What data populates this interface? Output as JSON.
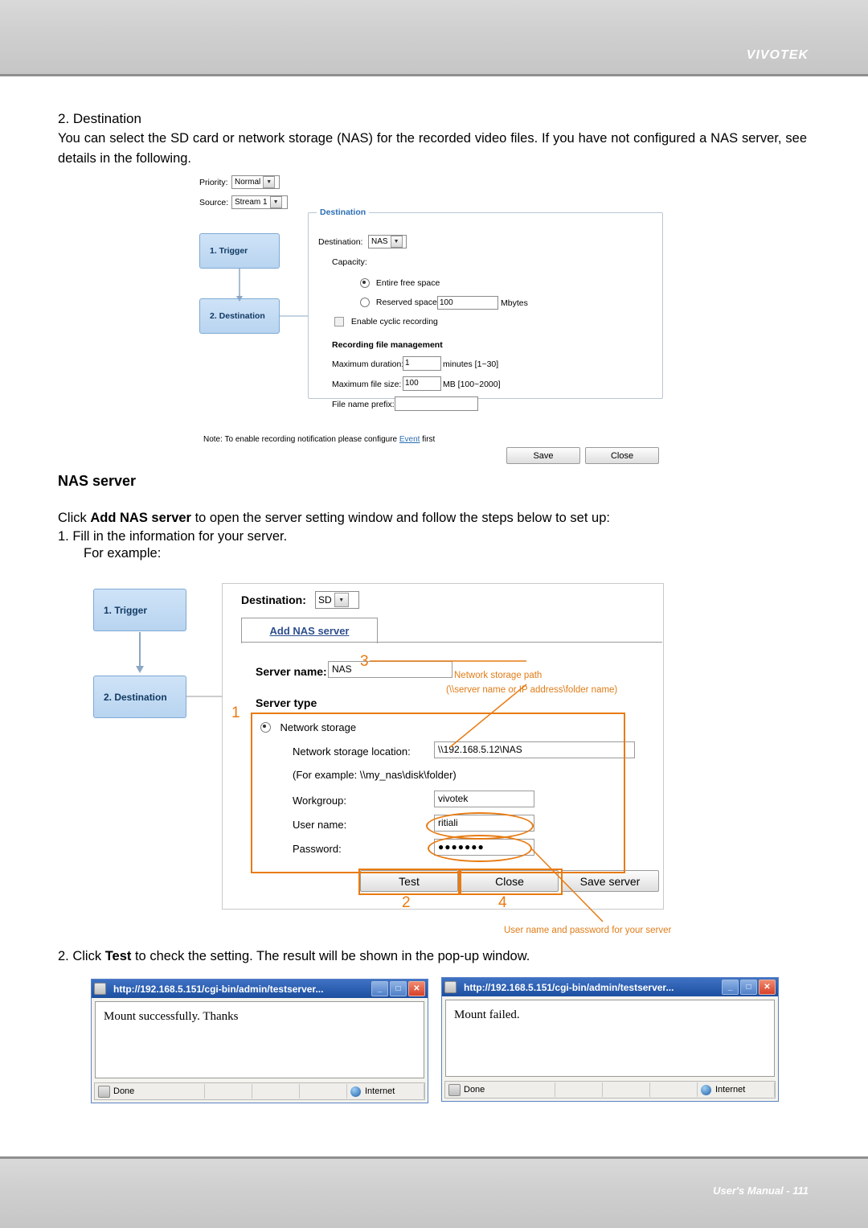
{
  "header": {
    "brand": "VIVOTEK"
  },
  "footer": {
    "text": "User's Manual - 111"
  },
  "content": {
    "section_number": "2. Destination",
    "paragraph1": "You can select the SD card or network storage (NAS) for the recorded video files. If you have not configured a NAS server, see details in the following.",
    "nas_heading": "NAS server",
    "paragraph2_prefix": "Click ",
    "paragraph2_bold": "Add NAS server",
    "paragraph2_suffix": " to open the server setting window and follow the steps below to set up:",
    "step1": "1. Fill in the information for your server.",
    "step1_sub": "For example:",
    "step2_prefix": "2. Click ",
    "step2_bold": "Test",
    "step2_suffix": " to check the setting. The result will be shown in the pop-up window."
  },
  "figure1": {
    "priority_label": "Priority:",
    "priority_value": "Normal",
    "source_label": "Source:",
    "source_value": "Stream 1",
    "node_trigger": "1. Trigger",
    "node_destination": "2. Destination",
    "group_title": "Destination",
    "destination_label": "Destination:",
    "destination_value": "NAS",
    "capacity_label": "Capacity:",
    "entire_free_space": "Entire free space",
    "reserved_space": "Reserved space:",
    "reserved_value": "100",
    "mbytes": "Mbytes",
    "enable_cyclic": "Enable cyclic recording",
    "rec_file_mgmt": "Recording file management",
    "max_duration_label": "Maximum duration:",
    "max_duration_value": "1",
    "max_duration_unit": "minutes [1~30]",
    "max_filesize_label": "Maximum file size:",
    "max_filesize_value": "100",
    "max_filesize_unit": "MB [100~2000]",
    "file_prefix_label": "File name prefix:",
    "file_prefix_value": "",
    "note_prefix": "Note: To enable recording notification please configure ",
    "note_link": "Event",
    "note_suffix": " first",
    "save_button": "Save",
    "close_button": "Close"
  },
  "figure2": {
    "node_trigger": "1. Trigger",
    "node_destination": "2. Destination",
    "destination_label": "Destination:",
    "destination_value": "SD",
    "tab_label": "Add NAS server",
    "server_name_label": "Server name:",
    "server_name_value": "NAS",
    "server_type_label": "Server type",
    "network_storage_label": "Network storage",
    "location_label": "Network storage location:",
    "location_value": "\\\\192.168.5.12\\NAS",
    "location_hint": "(For example: \\\\my_nas\\disk\\folder)",
    "workgroup_label": "Workgroup:",
    "workgroup_value": "vivotek",
    "username_label": "User name:",
    "username_value": "ritiali",
    "password_label": "Password:",
    "password_value": "●●●●●●●",
    "test_button": "Test",
    "close_button": "Close",
    "save_server_button": "Save server",
    "callout_path_title": "Network storage path",
    "callout_path_sub": "(\\\\server name or IP address\\folder name)",
    "callout_user": "User name and password for your server",
    "num1": "1",
    "num2": "2",
    "num3": "3",
    "num4": "4"
  },
  "popups": [
    {
      "title": "http://192.168.5.151/cgi-bin/admin/testserver...",
      "message": "Mount successfully. Thanks",
      "status_done": "Done",
      "status_zone": "Internet",
      "btn_min": "_",
      "btn_max": "□",
      "btn_close": "✕"
    },
    {
      "title": "http://192.168.5.151/cgi-bin/admin/testserver...",
      "message": "Mount failed.",
      "status_done": "Done",
      "status_zone": "Internet",
      "btn_min": "_",
      "btn_max": "□",
      "btn_close": "✕"
    }
  ],
  "colors": {
    "accent_orange": "#e87b12",
    "link_blue": "#2c6fb5",
    "header_gray": "#cfcfcf"
  }
}
